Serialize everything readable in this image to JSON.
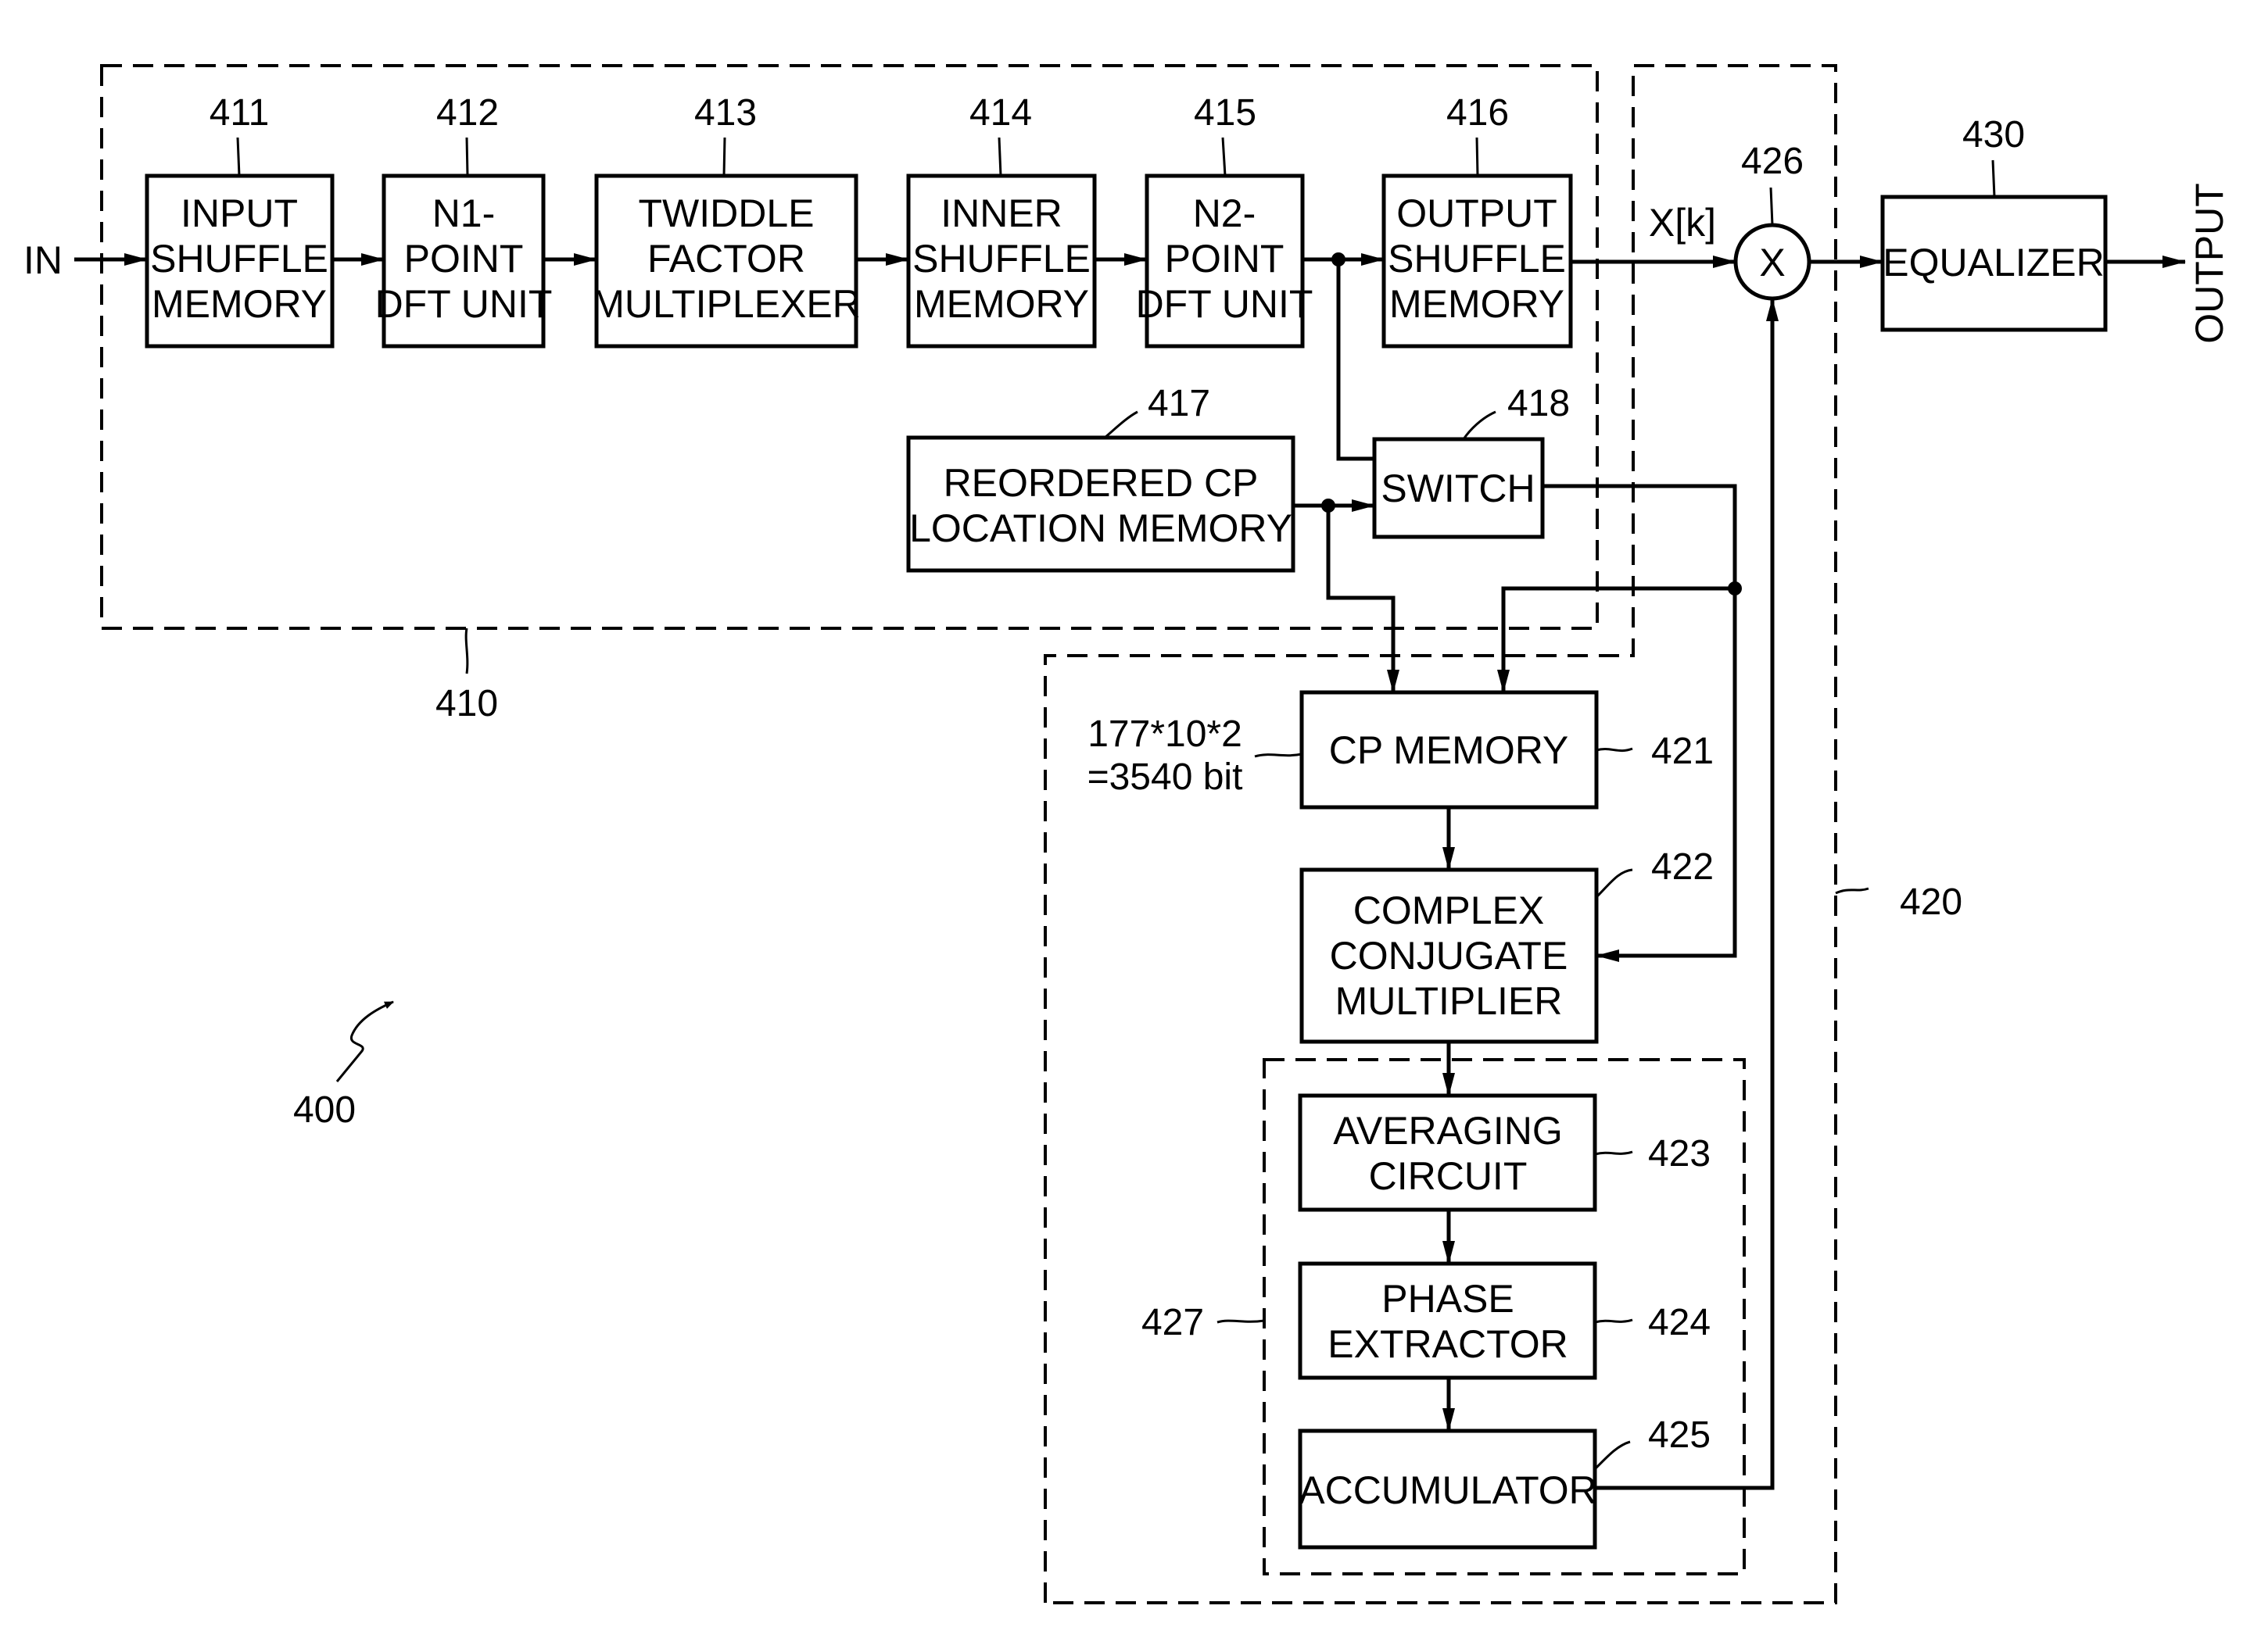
{
  "figure_label": "400",
  "input_label": "IN",
  "output_label": "OUTPUT",
  "signal_label": "X[k]",
  "memory_note": [
    "177*10*2",
    "=3540 bit"
  ],
  "groups": {
    "g410": "410",
    "g420": "420",
    "g427": "427"
  },
  "blocks": {
    "b411": {
      "ref": "411",
      "lines": [
        "INPUT",
        "SHUFFLE",
        "MEMORY"
      ]
    },
    "b412": {
      "ref": "412",
      "lines": [
        "N1-",
        "POINT",
        "DFT UNIT"
      ]
    },
    "b413": {
      "ref": "413",
      "lines": [
        "TWIDDLE",
        "FACTOR",
        "MULTIPLEXER"
      ]
    },
    "b414": {
      "ref": "414",
      "lines": [
        "INNER",
        "SHUFFLE",
        "MEMORY"
      ]
    },
    "b415": {
      "ref": "415",
      "lines": [
        "N2-",
        "POINT",
        "DFT UNIT"
      ]
    },
    "b416": {
      "ref": "416",
      "lines": [
        "OUTPUT",
        "SHUFFLE",
        "MEMORY"
      ]
    },
    "b417": {
      "ref": "417",
      "lines": [
        "REORDERED CP",
        "LOCATION MEMORY"
      ]
    },
    "b418": {
      "ref": "418",
      "lines": [
        "SWITCH"
      ]
    },
    "b421": {
      "ref": "421",
      "lines": [
        "CP MEMORY"
      ]
    },
    "b422": {
      "ref": "422",
      "lines": [
        "COMPLEX",
        "CONJUGATE",
        "MULTIPLIER"
      ]
    },
    "b423": {
      "ref": "423",
      "lines": [
        "AVERAGING",
        "CIRCUIT"
      ]
    },
    "b424": {
      "ref": "424",
      "lines": [
        "PHASE",
        "EXTRACTOR"
      ]
    },
    "b425": {
      "ref": "425",
      "lines": [
        "ACCUMULATOR"
      ]
    },
    "b426": {
      "ref": "426",
      "symbol": "X"
    },
    "b430": {
      "ref": "430",
      "lines": [
        "EQUALIZER"
      ]
    }
  }
}
